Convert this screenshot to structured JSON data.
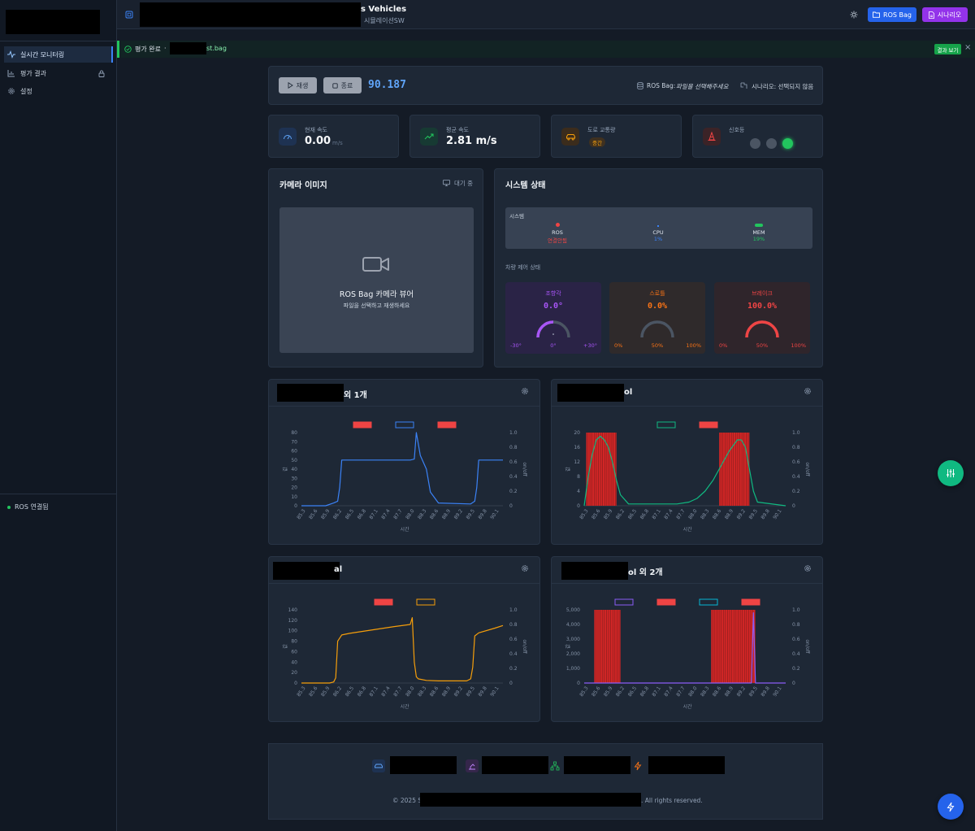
{
  "header": {
    "title_suffix": "s Vehicles",
    "subtitle": "시뮬레이션SW",
    "ros_bag_button": "ROS Bag",
    "scenario_button": "시나리오"
  },
  "sidebar": {
    "items": [
      {
        "label": "실시간 모니터링",
        "active": true
      },
      {
        "label": "평가 결과",
        "locked": true
      },
      {
        "label": "설정"
      }
    ],
    "status": "ROS 연결됨"
  },
  "banner": {
    "status": "평가 완료",
    "separator": "·",
    "file_suffix": "st.bag",
    "result_button": "결과 보기",
    "close": "×"
  },
  "player": {
    "play_label": "재생",
    "stop_label": "종료",
    "time": "90.187",
    "rosbag_label": "ROS Bag:",
    "rosbag_value": "파일을 선택해주세요",
    "scenario_label": "시나리오: 선택되지 않음"
  },
  "stats": {
    "current_speed": {
      "label": "현재 속도",
      "value": "0.00",
      "unit": "m/s"
    },
    "avg_speed": {
      "label": "평균 속도",
      "value": "2.81 m/s"
    },
    "traffic": {
      "label": "도로 교통량",
      "badge": "중간"
    },
    "signal": {
      "label": "신호등",
      "active": "green"
    }
  },
  "camera": {
    "title": "카메라 이미지",
    "status": "대기 중",
    "viewer_title": "ROS Bag 카메라 뷰어",
    "viewer_sub": "파일을 선택하고 재생하세요"
  },
  "system": {
    "title": "시스템 상태",
    "section": "시스템",
    "items": [
      {
        "name": "ROS",
        "value": "연결안됨",
        "color": "#ef4444"
      },
      {
        "name": "CPU",
        "value": "1%",
        "color": "#3b82f6"
      },
      {
        "name": "MEM",
        "value": "19%",
        "color": "#22c55e"
      }
    ],
    "control_section": "차량 제어 상태",
    "gauges": [
      {
        "name": "조향각",
        "value": "0.0°",
        "min": "-30°",
        "mid": "0°",
        "max": "+30°",
        "fill": 0.5,
        "color": "#a855f7",
        "bg": "#2a2346"
      },
      {
        "name": "스로틀",
        "value": "0.0%",
        "min": "0%",
        "mid": "50%",
        "max": "100%",
        "fill": 0.0,
        "color": "#f97316",
        "bg": "#2f2a2b"
      },
      {
        "name": "브레이크",
        "value": "100.0%",
        "min": "0%",
        "mid": "50%",
        "max": "100%",
        "fill": 1.0,
        "color": "#ef4444",
        "bg": "#2f252b"
      }
    ]
  },
  "chart_panels": [
    {
      "title_suffix": "외 1개"
    },
    {
      "title_suffix": "ol"
    },
    {
      "title_suffix": "al"
    },
    {
      "title_suffix": "ol 외 2개"
    }
  ],
  "chart_data": [
    {
      "type": "line",
      "xlabel": "시간",
      "ylabel": "값",
      "y2label": "on/off",
      "ylim": [
        0,
        80
      ],
      "yticks": [
        0,
        10,
        20,
        30,
        40,
        50,
        60,
        70,
        80
      ],
      "y2ticks": [
        "0",
        "0.2",
        "0.4",
        "0.6",
        "0.8",
        "1.0"
      ],
      "xticks": [
        "85.3",
        "85.6",
        "85.9",
        "86.2",
        "86.5",
        "86.8",
        "87.1",
        "87.4",
        "87.7",
        "88.0",
        "88.3",
        "88.6",
        "88.9",
        "89.2",
        "89.5",
        "89.8",
        "90.1"
      ],
      "legend": [
        {
          "color": "#ef4444",
          "filled": true
        },
        {
          "color": "#3b82f6",
          "filled": false
        },
        {
          "color": "#ef4444",
          "filled": true
        }
      ],
      "series": [
        {
          "color": "#3b82f6",
          "x": [
            85.2,
            85.8,
            86.0,
            86.1,
            86.15,
            86.2,
            87.9,
            88.0,
            88.05,
            88.15,
            88.2,
            88.3,
            88.4,
            88.6,
            89.4,
            89.5,
            89.55,
            89.6,
            90.0,
            90.2
          ],
          "y": [
            0,
            0,
            3,
            5,
            20,
            50,
            50,
            51,
            80,
            55,
            50,
            40,
            15,
            3,
            2,
            5,
            20,
            50,
            50,
            50
          ]
        }
      ]
    },
    {
      "type": "line",
      "xlabel": "시간",
      "ylabel": "값",
      "y2label": "on/off",
      "ylim": [
        0,
        20
      ],
      "yticks": [
        0,
        4,
        8,
        12,
        16,
        20
      ],
      "y2ticks": [
        "0",
        "0.2",
        "0.4",
        "0.6",
        "0.8",
        "1.0"
      ],
      "xticks": [
        "85.3",
        "85.6",
        "85.9",
        "86.2",
        "86.5",
        "86.8",
        "87.1",
        "87.4",
        "87.7",
        "88.0",
        "88.3",
        "88.6",
        "88.9",
        "89.2",
        "89.5",
        "89.8",
        "90.1"
      ],
      "legend": [
        {
          "color": "#10b981",
          "filled": false
        },
        {
          "color": "#ef4444",
          "filled": true
        }
      ],
      "bands": [
        {
          "x0": 85.25,
          "x1": 86.0,
          "color": "#dc2626"
        },
        {
          "x0": 88.55,
          "x1": 89.3,
          "color": "#dc2626"
        }
      ],
      "series": [
        {
          "color": "#10b981",
          "x": [
            85.2,
            85.3,
            85.4,
            85.5,
            85.6,
            85.7,
            85.8,
            85.9,
            86.0,
            86.1,
            86.3,
            87.5,
            87.8,
            88.0,
            88.2,
            88.4,
            88.6,
            88.8,
            89.0,
            89.1,
            89.2,
            89.3,
            89.4,
            89.5,
            90.2
          ],
          "y": [
            0,
            8,
            14,
            18,
            19,
            18,
            16,
            12,
            7,
            3,
            0.5,
            0.5,
            1,
            2,
            4,
            7,
            11,
            15,
            18,
            18,
            16,
            10,
            4,
            1,
            0
          ]
        }
      ]
    },
    {
      "type": "line",
      "xlabel": "시간",
      "ylabel": "값",
      "y2label": "on/off",
      "ylim": [
        0,
        140
      ],
      "yticks": [
        0,
        20,
        40,
        60,
        80,
        100,
        120,
        140
      ],
      "y2ticks": [
        "0",
        "0.2",
        "0.4",
        "0.6",
        "0.8",
        "1.0"
      ],
      "xticks": [
        "85.3",
        "85.6",
        "85.9",
        "86.2",
        "86.5",
        "86.8",
        "87.1",
        "87.4",
        "87.7",
        "88.0",
        "88.3",
        "88.6",
        "88.9",
        "89.2",
        "89.5",
        "89.8",
        "90.1"
      ],
      "legend": [
        {
          "color": "#ef4444",
          "filled": true
        },
        {
          "color": "#f59e0b",
          "filled": false
        }
      ],
      "series": [
        {
          "color": "#f59e0b",
          "x": [
            85.2,
            85.9,
            86.0,
            86.05,
            86.1,
            86.2,
            86.4,
            87.0,
            87.5,
            87.9,
            87.95,
            88.0,
            88.05,
            88.1,
            88.3,
            88.6,
            89.3,
            89.4,
            89.45,
            89.5,
            89.6,
            90.0,
            90.2
          ],
          "y": [
            0,
            0,
            2,
            10,
            80,
            92,
            95,
            102,
            108,
            112,
            125,
            40,
            12,
            8,
            5,
            4,
            4,
            8,
            30,
            90,
            96,
            105,
            110
          ]
        }
      ]
    },
    {
      "type": "line",
      "xlabel": "시간",
      "ylabel": "값",
      "y2label": "on/off",
      "ylim": [
        0,
        5000
      ],
      "yticks": [
        0,
        1000,
        2000,
        3000,
        4000,
        5000
      ],
      "yticklabels": [
        "0",
        "1,000",
        "2,000",
        "3,000",
        "4,000",
        "5,000"
      ],
      "y2ticks": [
        "0",
        "0.2",
        "0.4",
        "0.6",
        "0.8",
        "1.0"
      ],
      "xticks": [
        "85.3",
        "85.6",
        "85.9",
        "86.2",
        "86.5",
        "86.8",
        "87.1",
        "87.4",
        "87.7",
        "88.0",
        "88.3",
        "88.6",
        "88.9",
        "89.2",
        "89.5",
        "89.8",
        "90.1"
      ],
      "legend": [
        {
          "color": "#8b5cf6",
          "filled": false
        },
        {
          "color": "#ef4444",
          "filled": true
        },
        {
          "color": "#06b6d4",
          "filled": false
        },
        {
          "color": "#ef4444",
          "filled": true
        }
      ],
      "bands": [
        {
          "x0": 85.45,
          "x1": 86.1,
          "color": "#dc2626"
        },
        {
          "x0": 88.35,
          "x1": 89.45,
          "color": "#dc2626"
        }
      ],
      "series": [
        {
          "color": "#8b5cf6",
          "x": [
            85.2,
            89.35,
            89.4,
            89.45,
            89.5,
            90.2
          ],
          "y": [
            0,
            0,
            4800,
            0,
            0,
            0
          ]
        }
      ]
    }
  ],
  "footer": {
    "copyright_prefix": "© 2025 S",
    "copyright_suffix": ". All rights reserved."
  }
}
